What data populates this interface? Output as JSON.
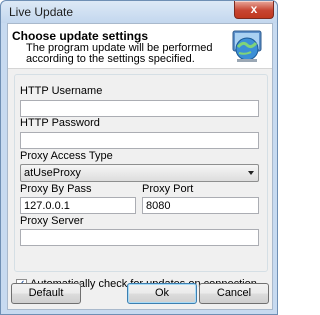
{
  "window": {
    "title": "Live Update",
    "close_glyph": "x"
  },
  "header": {
    "title": "Choose update settings",
    "description": "The program update will be performed according to the settings specified.",
    "icon": "globe-update-icon"
  },
  "form": {
    "http_username": {
      "label": "HTTP Username",
      "value": ""
    },
    "http_password": {
      "label": "HTTP Password",
      "value": ""
    },
    "proxy_access_type": {
      "label": "Proxy Access Type",
      "value": "atUseProxy"
    },
    "proxy_bypass": {
      "label": "Proxy By Pass",
      "value": "127.0.0.1"
    },
    "proxy_port": {
      "label": "Proxy Port",
      "value": "8080"
    },
    "proxy_server": {
      "label": "Proxy Server",
      "value": ""
    }
  },
  "auto_check": {
    "label": "Automatically check for updates on connection",
    "checked": true
  },
  "buttons": {
    "default_label": "Default",
    "ok_label": "Ok",
    "cancel_label": "Cancel"
  }
}
